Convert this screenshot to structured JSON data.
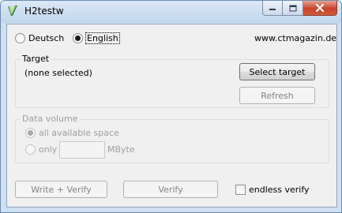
{
  "window": {
    "title": "H2testw",
    "icon": "h2testw-app-icon",
    "caption_buttons": [
      "minimize-icon",
      "maximize-icon",
      "close-icon"
    ]
  },
  "language": {
    "options": [
      {
        "label": "Deutsch",
        "selected": false
      },
      {
        "label": "English",
        "selected": true
      }
    ],
    "website": "www.ctmagazin.de"
  },
  "target": {
    "group_label": "Target",
    "status": "(none selected)",
    "select_button": "Select target",
    "refresh_button": "Refresh"
  },
  "data_volume": {
    "group_label": "Data volume",
    "option_all": "all available space",
    "option_only": "only",
    "only_value": "",
    "unit": "MByte"
  },
  "actions": {
    "write_verify_button": "Write + Verify",
    "verify_button": "Verify",
    "endless_verify_label": "endless verify",
    "endless_verify_checked": false
  }
}
